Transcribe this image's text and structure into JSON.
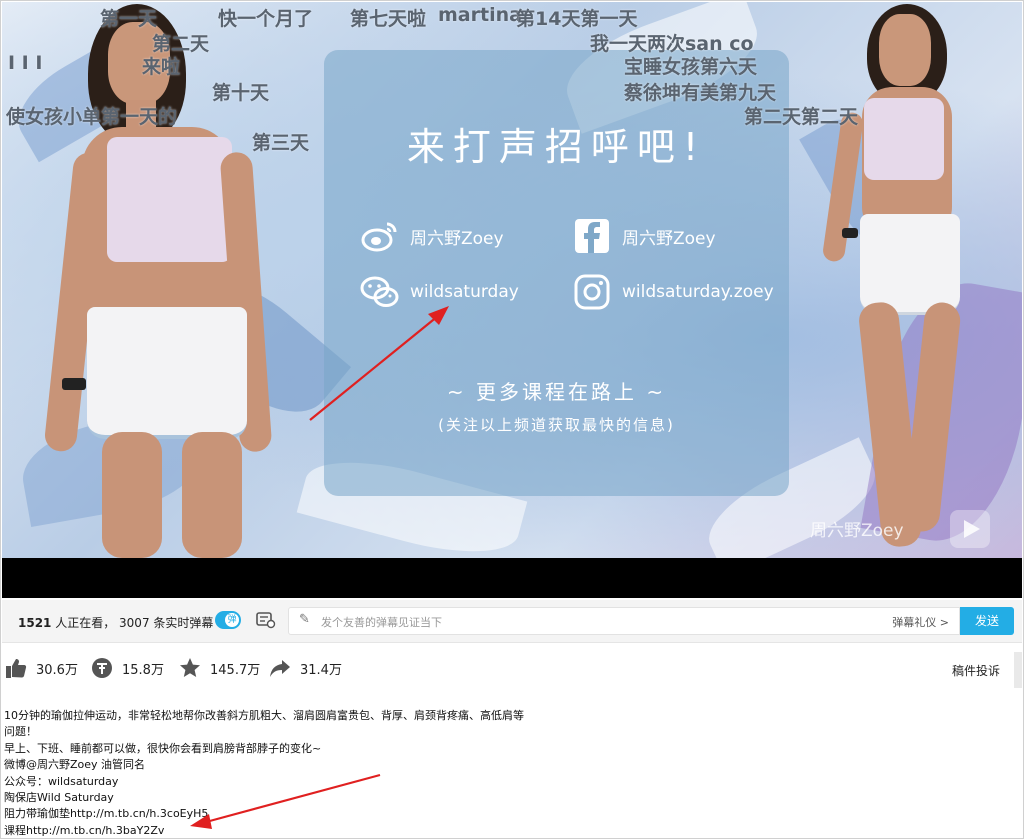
{
  "video": {
    "card": {
      "title": "来打声招呼吧!",
      "socials": [
        {
          "icon": "weibo-icon",
          "label": "周六野Zoey"
        },
        {
          "icon": "facebook-icon",
          "label": "周六野Zoey"
        },
        {
          "icon": "wechat-icon",
          "label": "wildsaturday"
        },
        {
          "icon": "instagram-icon",
          "label": "wildsaturday.zoey"
        }
      ],
      "subtitle": "~ 更多课程在路上 ~",
      "note": "(关注以上频道获取最快的信息)"
    },
    "watermark": "周六野Zoey",
    "danmaku": [
      "第一天",
      "快一个月了",
      "第七天啦",
      "martina",
      "第14天第一天",
      "第二天",
      "我一天两次san co",
      "I I I",
      "来啦",
      "宝睡女孩第六天",
      "第十天",
      "蔡徐坤有美第九天",
      "使女孩小单第一天的",
      "第二天第二天",
      "第三天"
    ]
  },
  "danmaku_bar": {
    "viewer_count": "1521",
    "viewer_text": " 人正在看， 3007 条实时弹幕",
    "toggle_label": "弹",
    "input_placeholder": "发个友善的弹幕见证当下",
    "etiquette": "弹幕礼仪 >",
    "send_label": "发送"
  },
  "stats": {
    "like": "30.6万",
    "coin": "15.8万",
    "favorite": "145.7万",
    "share": "31.4万",
    "report": "稿件投诉"
  },
  "description": [
    "10分钟的瑜伽拉伸运动，非常轻松地帮你改善斜方肌粗大、溜肩圆肩富贵包、背厚、肩颈背疼痛、高低肩等",
    "问题！",
    "早上、下班、睡前都可以做，很快你会看到肩膀背部脖子的变化~",
    "微博@周六野Zoey 油管同名",
    "公众号：wildsaturday",
    "陶保店Wild Saturday",
    "阻力带瑜伽垫http://m.tb.cn/h.3coEyH5",
    "课程http://m.tb.cn/h.3baY2Zv"
  ],
  "colors": {
    "accent": "#23ade5",
    "arrow": "#e02020"
  }
}
